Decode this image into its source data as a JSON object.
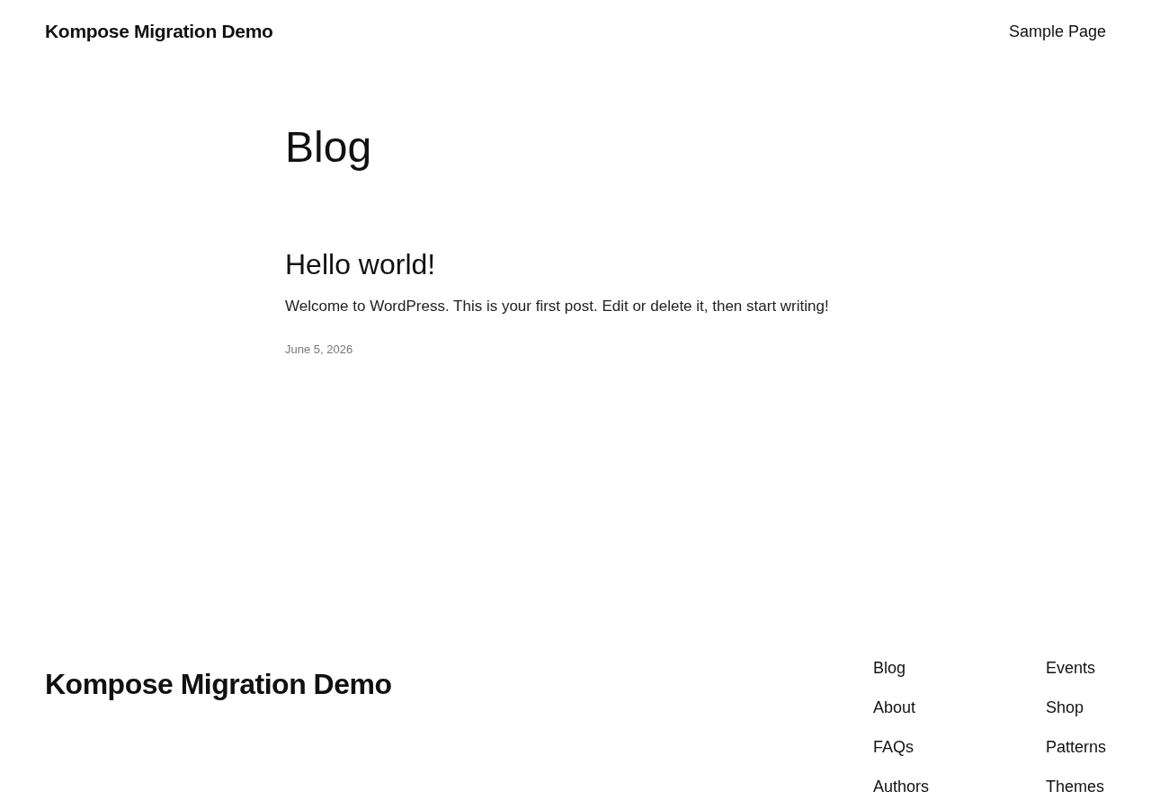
{
  "header": {
    "site_title": "Kompose Migration Demo",
    "nav": [
      "Sample Page"
    ]
  },
  "page_title": "Blog",
  "posts": [
    {
      "title": "Hello world!",
      "excerpt": "Welcome to WordPress. This is your first post. Edit or delete it, then start writing!",
      "date": "June 5, 2026"
    }
  ],
  "footer": {
    "site_title": "Kompose Migration Demo",
    "nav_columns": [
      [
        "Blog",
        "About",
        "FAQs",
        "Authors"
      ],
      [
        "Events",
        "Shop",
        "Patterns",
        "Themes"
      ]
    ]
  }
}
